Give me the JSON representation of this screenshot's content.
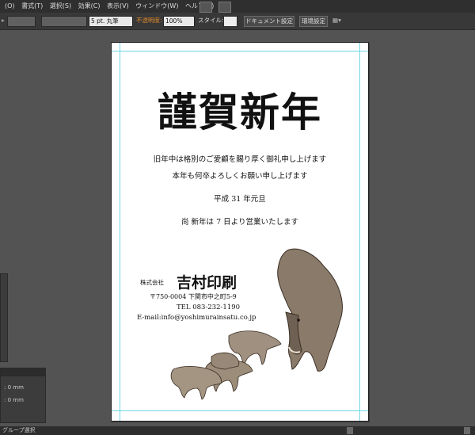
{
  "menu": [
    "(O)",
    "書式(T)",
    "選択(S)",
    "効果(C)",
    "表示(V)",
    "ウィンドウ(W)",
    "ヘルプ(H)"
  ],
  "toolbar": {
    "stroke_weight": "5 pt. 丸筆",
    "opacity_label": "不透明度:",
    "opacity_value": "100%",
    "style_label": "スタイル:",
    "doc_settings": "ドキュメント設定",
    "env_settings": "環境設定"
  },
  "card": {
    "title": "謹賀新年",
    "line1": "旧年中は格別のご愛顧を賜り厚く御礼申し上げます",
    "line2": "本年も何卒よろしくお願い申し上げます",
    "date": "平成 31 年元旦",
    "notice": "尚 新年は 7 日より営業いたします",
    "company_prefix": "株式会社",
    "company_name": "吉村印刷",
    "address": "〒750-0004 下関市中之町5-9",
    "tel": "TEL 083-232-1190",
    "email": "E-mail:info@yoshimurainsatu.co.jp"
  },
  "panel": {
    "field1": ": 0 mm",
    "field2": ": 0 mm"
  },
  "status": {
    "tool": "グループ選択"
  }
}
